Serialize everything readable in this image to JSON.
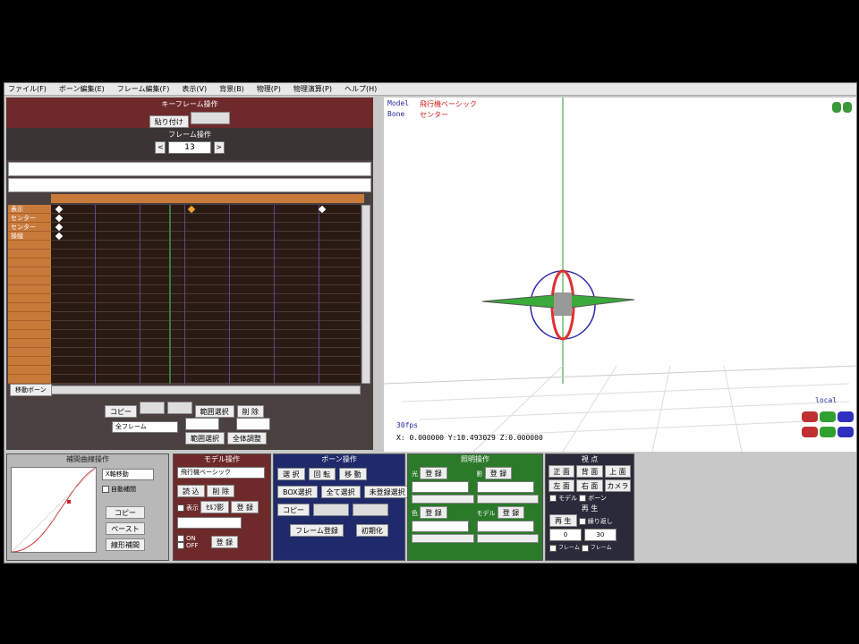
{
  "menu": [
    "ファイル(F)",
    "ボーン編集(E)",
    "フレーム編集(F)",
    "表示(V)",
    "背景(B)",
    "物理(P)",
    "物理演算(P)",
    "ヘルプ(H)"
  ],
  "keyframe_panel": {
    "title": "キーフレーム操作",
    "btn1": "貼り付け",
    "btn2": "",
    "frame_title": "フレーム操作",
    "frame_value": "13",
    "prev": "<",
    "next": ">"
  },
  "timeline": {
    "tracks": [
      "表示",
      "センター",
      "センター",
      "操縦"
    ],
    "scroll_button": "移動ボーン"
  },
  "lower_left": {
    "copy": "コピー",
    "paste": "",
    "rev": "",
    "range_sel": "範囲選択",
    "delete": "削 除",
    "frame_select": "全フレーム",
    "range_btn": "範囲選択",
    "adjust_btn": "全体調整"
  },
  "viewport": {
    "model_label": "Model",
    "model_value": "飛行機ベーシック",
    "bone_label": "Bone",
    "bone_value": "センター",
    "fps": "30fps",
    "coords": "X: 0.000000 Y:10.493029 Z:0.000000",
    "local": "local"
  },
  "interp_panel": {
    "title": "補間曲線操作",
    "select": "X軸移動",
    "auto_check": "自動補間",
    "copy": "コピー",
    "paste": "ペースト",
    "linear": "線形補間"
  },
  "model_panel": {
    "title": "モデル操作",
    "select": "飛行機ベーシック",
    "load": "読 込",
    "delete": "削 除",
    "display": "表示",
    "sel_label": "ｾﾙﾌ影",
    "register": "登 録",
    "mode": "",
    "on": "ON",
    "off": "OFF"
  },
  "bone_panel": {
    "title": "ボーン操作",
    "select": "選 択",
    "rotate": "回 転",
    "move": "移 動",
    "ik_sel": "BOX選択",
    "all_sel": "全て選択",
    "unreg_sel": "未登録選択",
    "copy": "コピー",
    "paste": "",
    "inv_paste": "",
    "frame_reg": "フレーム登録",
    "init": "初期化"
  },
  "light_panel": {
    "title": "照明操作",
    "reg1": "登 録",
    "reg2": "登 録",
    "reg3": "登 録",
    "reg4": "登 録",
    "l1": "光",
    "l2": "影",
    "l3": "色",
    "l4": "モデル"
  },
  "view_panel": {
    "title": "視 点",
    "front": "正 面",
    "back": "背 面",
    "top": "上 面",
    "left": "左 面",
    "right": "右 面",
    "camera": "カメラ",
    "model_chk": "モデル",
    "bone_chk": "ボーン",
    "play_title": "再 生",
    "play": "再 生",
    "loop": "繰り返し",
    "from": "0",
    "to": "30",
    "sel1": "フレーム",
    "sel2": "フレーム"
  }
}
